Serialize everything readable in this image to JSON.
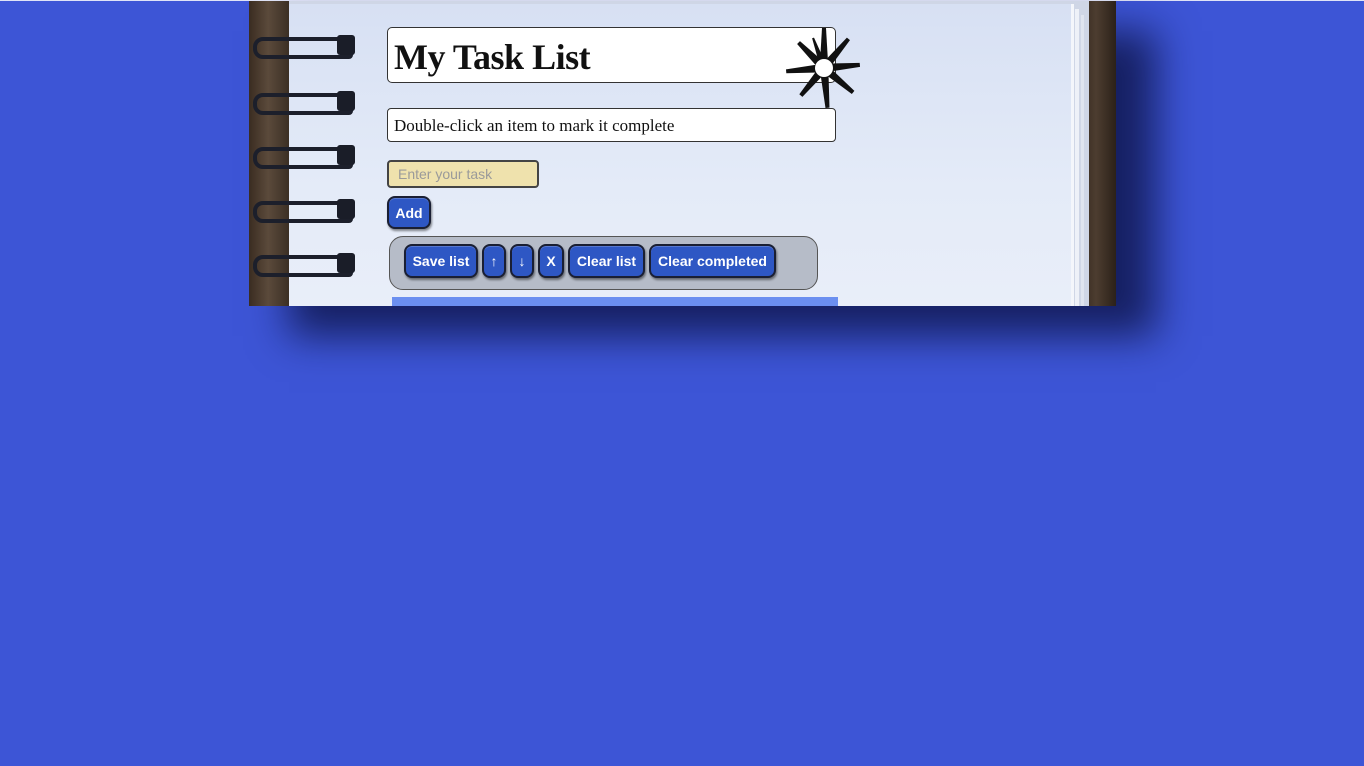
{
  "app": {
    "title": "My Task List",
    "hint": "Double-click an item to mark it complete"
  },
  "form": {
    "task_placeholder": "Enter your task",
    "task_value": "",
    "add_label": "Add"
  },
  "toolbar": {
    "save_label": "Save list",
    "move_up_label": "↑",
    "move_down_label": "↓",
    "delete_label": "X",
    "clear_label": "Clear list",
    "clear_completed_label": "Clear completed"
  },
  "tasks": [],
  "colors": {
    "page_background": "#3d55d6",
    "button": "#2e57c4",
    "input_background": "#efe2ad",
    "toolbar_background": "#b6bcc8",
    "list_background": "#6b8ff0"
  },
  "icons": {
    "decoration": "starburst-icon"
  }
}
